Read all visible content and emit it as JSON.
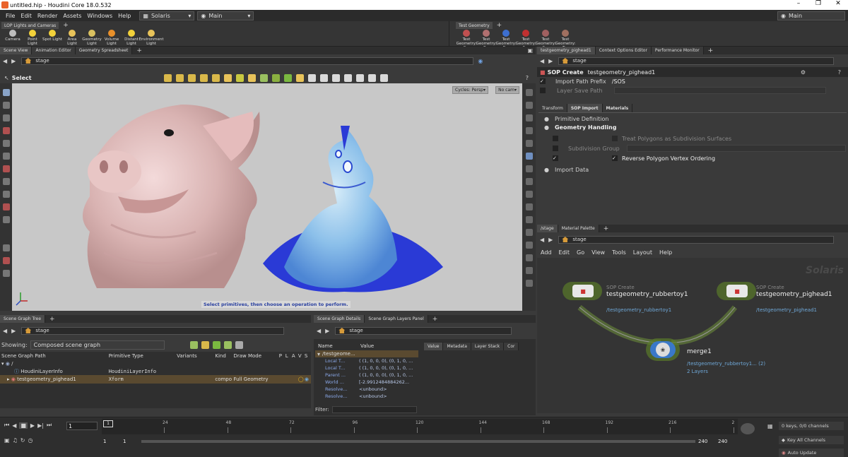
{
  "window": {
    "title": "untitled.hip - Houdini Core 18.0.532"
  },
  "menubar": {
    "items": [
      "File",
      "Edit",
      "Render",
      "Assets",
      "Windows",
      "Help"
    ],
    "desktop": "Solaris",
    "context": "Main",
    "right_context": "Main"
  },
  "shelf_left": {
    "tab": "LOP Lights and Cameras",
    "tools": [
      {
        "label": "Camera",
        "color": "#bdbdbd"
      },
      {
        "label": "Point Light",
        "color": "#f2d13a"
      },
      {
        "label": "Spot Light",
        "color": "#f2d13a"
      },
      {
        "label": "Area Light",
        "color": "#e8c35a"
      },
      {
        "label": "Geometry Light",
        "color": "#d9c060"
      },
      {
        "label": "Volume Light",
        "color": "#e8902a"
      },
      {
        "label": "Distant Light",
        "color": "#f2d13a"
      },
      {
        "label": "Environment Light",
        "color": "#e8c35a"
      }
    ]
  },
  "shelf_right": {
    "tab": "Test Geometry",
    "tools": [
      {
        "label": "Test Geometry: C...",
        "color": "#c05050"
      },
      {
        "label": "Test Geometry: P...",
        "color": "#b07070"
      },
      {
        "label": "Test Geometry: R...",
        "color": "#3d6fd0"
      },
      {
        "label": "Test Geometry: S...",
        "color": "#c03030"
      },
      {
        "label": "Test Geometry: S...",
        "color": "#a06060"
      },
      {
        "label": "Test Geometry: T...",
        "color": "#a07060"
      }
    ]
  },
  "scene_view": {
    "tabs": [
      "Scene View",
      "Animation Editor",
      "Geometry Spreadsheet"
    ],
    "path": "stage",
    "tool_label": "Select",
    "camera_menu": "Cycles: Persp",
    "cam_menu": "No cam",
    "status_message": "Select primitives, then choose an operation to perform."
  },
  "parameter_pane": {
    "tabs": [
      "testgeometry_pighead1",
      "Context Options Editor",
      "Performance Monitor"
    ],
    "path": "stage",
    "node_type": "SOP Create",
    "node_name": "testgeometry_pighead1",
    "import_path_prefix_label": "Import Path Prefix",
    "import_path_prefix_value": "/SOS",
    "layer_save_path_label": "Layer Save Path",
    "sub_tabs": [
      "Transform",
      "SOP Import",
      "Materials"
    ],
    "sections": {
      "primitive_definition": "Primitive Definition",
      "geometry_handling": "Geometry Handling",
      "treat_polygons": "Treat Polygons as Subdivision Surfaces",
      "subdivision_group": "Subdivision Group",
      "reverse_polygon": "Reverse Polygon Vertex Ordering",
      "import_data": "Import Data"
    }
  },
  "network_pane": {
    "tabs": [
      "/stage",
      "Material Palette"
    ],
    "path": "stage",
    "menu": [
      "Add",
      "Edit",
      "Go",
      "View",
      "Tools",
      "Layout",
      "Help"
    ],
    "watermark": "Solaris",
    "nodes": {
      "rubbertoy": {
        "type": "SOP Create",
        "name": "testgeometry_rubbertoy1",
        "path": "/testgeometry_rubbertoy1"
      },
      "pighead": {
        "type": "SOP Create",
        "name": "testgeometry_pighead1",
        "path": "/testgeometry_pighead1"
      },
      "merge": {
        "name": "merge1",
        "info1": "/testgeometry_rubbertoy1... (2)",
        "info2": "2 Layers"
      }
    }
  },
  "scene_graph_tree": {
    "tabs": [
      "Scene Graph Tree"
    ],
    "path": "stage",
    "showing_label": "Showing:",
    "showing_value": "Composed scene graph",
    "columns": [
      "Scene Graph Path",
      "Primitive Type",
      "Variants",
      "Kind",
      "Draw Mode",
      "P",
      "L",
      "A",
      "V",
      "S"
    ],
    "rows": [
      {
        "path": "/",
        "type": "",
        "kind": "",
        "draw": ""
      },
      {
        "path": "HoudiniLayerInfo",
        "type": "HoudiniLayerInfo",
        "kind": "",
        "draw": ""
      },
      {
        "path": "testgeometry_pighead1",
        "type": "Xform",
        "kind": "compo",
        "draw": "Full Geometry"
      }
    ]
  },
  "scene_graph_details": {
    "tabs": [
      "Scene Graph Details",
      "Scene Graph Layers Panel"
    ],
    "path": "stage",
    "columns": [
      "Name",
      "Value"
    ],
    "root": "/testgeome...",
    "rows": [
      {
        "name": "Local T...",
        "value": "( (1, 0, 0, 0), (0, 1, 0, ..."
      },
      {
        "name": "Local T...",
        "value": "( (1, 0, 0, 0), (0, 1, 0, ..."
      },
      {
        "name": "Parent ...",
        "value": "( (1, 0, 0, 0), (0, 1, 0, ..."
      },
      {
        "name": "World ...",
        "value": "[-2.9912484884262..."
      },
      {
        "name": "Resolve...",
        "value": "<unbound>"
      },
      {
        "name": "Resolve...",
        "value": "<unbound>"
      }
    ],
    "right_tabs": [
      "Value",
      "Metadata",
      "Layer Stack",
      "Cor"
    ],
    "filter_label": "Filter:"
  },
  "timeline": {
    "frame": "1",
    "ticks": [
      "24",
      "48",
      "72",
      "96",
      "120",
      "144",
      "168",
      "192",
      "216",
      "2"
    ],
    "range_start": "1",
    "range_start2": "1",
    "range_end": "240",
    "range_end2": "240",
    "keys_label": "0 keys, 0/0 channels",
    "key_all": "Key All Channels",
    "auto_update": "Auto Update"
  }
}
